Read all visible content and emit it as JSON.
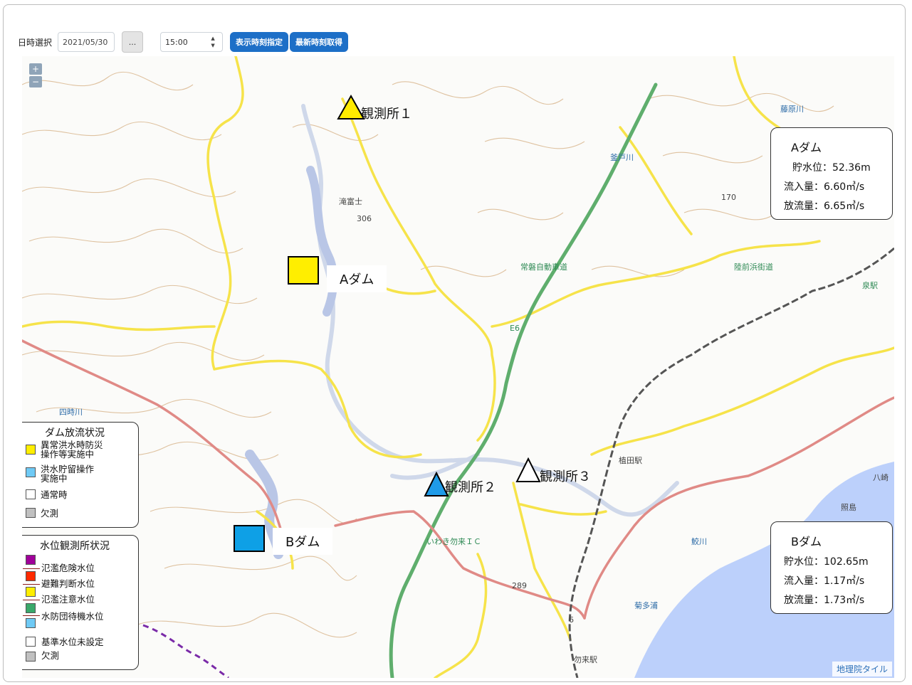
{
  "toolbar": {
    "date_label": "日時選択",
    "date_value": "2021/05/30",
    "dots_label": "...",
    "time_value": "15:00",
    "display_time_button": "表示時刻指定",
    "latest_time_button": "最新時刻取得"
  },
  "map": {
    "zoom_in": "+",
    "zoom_out": "−",
    "credit": "地理院タイル",
    "place_labels": [
      "滝富士",
      "306",
      "170",
      "釜戸川",
      "常磐自動車道",
      "陸前浜街道",
      "泉駅",
      "藤原川",
      "四時川",
      "植田駅",
      "八崎",
      "照島",
      "鮫川",
      "菊多浦",
      "勿来駅",
      "いわき勿来ＩＣ",
      "E6",
      "289",
      "6"
    ]
  },
  "stations": [
    {
      "name": "観測所１",
      "color": "#ffeb00"
    },
    {
      "name": "観測所２",
      "color": "#1f9be8"
    },
    {
      "name": "観測所３",
      "color": "#ffffff"
    }
  ],
  "dams": [
    {
      "name": "Aダム",
      "color": "#ffee00"
    },
    {
      "name": "Bダム",
      "color": "#0ea0e6"
    }
  ],
  "infoboxes": {
    "a": {
      "title": "Aダム",
      "storage": "貯水位：52.36m",
      "inflow": "流入量：6.60㎥/s",
      "outflow": "放流量：6.65㎥/s"
    },
    "b": {
      "title": "Bダム",
      "storage": "貯水位：102.65m",
      "inflow": "流入量：1.17㎥/s",
      "outflow": "放流量：1.73㎥/s"
    }
  },
  "dam_legend": {
    "title": "ダム放流状況",
    "items": [
      {
        "label": "異常洪水時防災\n操作等実施中",
        "color": "#ffee00"
      },
      {
        "label": "洪水貯留操作\n実施中",
        "color": "#6fcaf5"
      },
      {
        "label": "通常時",
        "color": "#ffffff"
      },
      {
        "label": "欠測",
        "color": "#c0c0c0"
      }
    ]
  },
  "station_legend": {
    "title": "水位観測所状況",
    "items": [
      {
        "label": "氾濫危険水位",
        "color": "#a0009a"
      },
      {
        "label": "避難判断水位",
        "color": "#ff2a00"
      },
      {
        "label": "氾濫注意水位",
        "color": "#ffee00"
      },
      {
        "label": "水防団待機水位",
        "color": "#3aa86a"
      },
      {
        "label": "",
        "color": "#6fcaf5"
      },
      {
        "label": "基準水位未設定",
        "color": "#ffffff"
      },
      {
        "label": "欠測",
        "color": "#c0c0c0"
      }
    ]
  }
}
